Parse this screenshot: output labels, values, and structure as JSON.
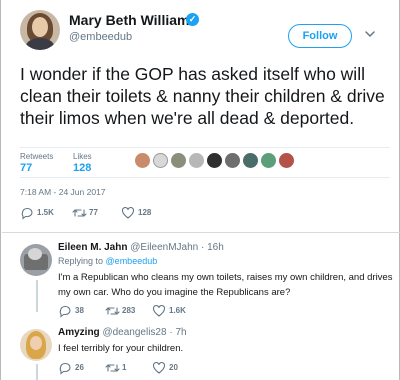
{
  "tweet": {
    "author": {
      "name": "Mary Beth Williams",
      "handle": "@embeedub",
      "verified": true
    },
    "follow_label": "Follow",
    "text": "I wonder if the GOP has asked itself who will clean their toilets & nanny their children & drive their limos when we're all dead & deported.",
    "retweets_label": "Retweets",
    "retweets": "77",
    "likes_label": "Likes",
    "likes": "128",
    "timestamp": "7:18 AM - 24 Jun 2017",
    "actions": {
      "replies": "1.5K",
      "retweets": "77",
      "likes": "128"
    }
  },
  "replies": [
    {
      "name": "Eileen M. Jahn",
      "handle": "@EileenMJahn",
      "time": "16h",
      "replying_prefix": "Replying to",
      "replying_to": "@embeedub",
      "line1": "I'm a Republican who cleans my own toilets, raises my own children, and drives",
      "line2": "my own car.  Who do you imagine the Republicans are?",
      "actions": {
        "replies": "38",
        "retweets": "283",
        "likes": "1.6K"
      }
    },
    {
      "name": "Amyzing",
      "handle": "@deangelis28",
      "time": "7h",
      "line1": "I feel terribly for your children.",
      "actions": {
        "replies": "26",
        "retweets": "1",
        "likes": "20"
      }
    }
  ],
  "colors": {
    "accent": "#1da1f2",
    "muted": "#657786",
    "text": "#14171a",
    "divider": "#e6ecf0"
  },
  "icons": [
    "verified-badge-icon",
    "chevron-down-icon",
    "reply-icon",
    "retweet-icon",
    "like-icon"
  ]
}
